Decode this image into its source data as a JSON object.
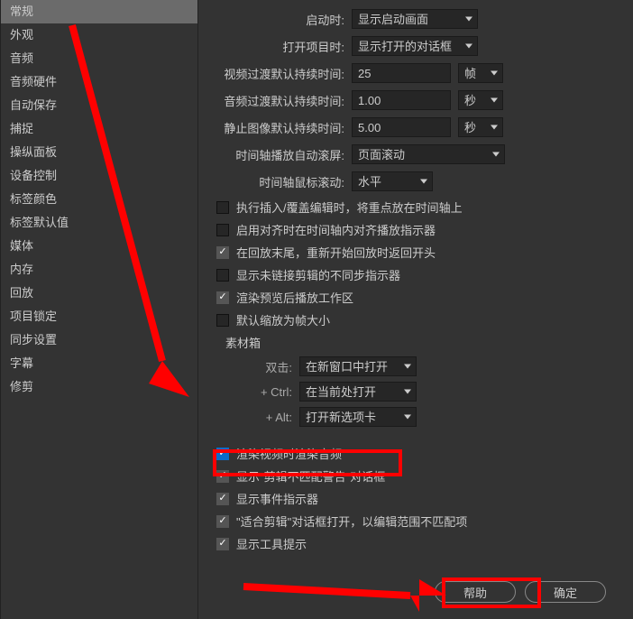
{
  "sidebar": {
    "items": [
      {
        "label": "常规",
        "name": "sidebar-item-general",
        "active": true
      },
      {
        "label": "外观",
        "name": "sidebar-item-appearance"
      },
      {
        "label": "音频",
        "name": "sidebar-item-audio"
      },
      {
        "label": "音频硬件",
        "name": "sidebar-item-audio-hardware"
      },
      {
        "label": "自动保存",
        "name": "sidebar-item-autosave"
      },
      {
        "label": "捕捉",
        "name": "sidebar-item-capture"
      },
      {
        "label": "操纵面板",
        "name": "sidebar-item-control-surface"
      },
      {
        "label": "设备控制",
        "name": "sidebar-item-device-control"
      },
      {
        "label": "标签颜色",
        "name": "sidebar-item-label-colors"
      },
      {
        "label": "标签默认值",
        "name": "sidebar-item-label-defaults"
      },
      {
        "label": "媒体",
        "name": "sidebar-item-media"
      },
      {
        "label": "内存",
        "name": "sidebar-item-memory"
      },
      {
        "label": "回放",
        "name": "sidebar-item-playback"
      },
      {
        "label": "项目锁定",
        "name": "sidebar-item-project-lock"
      },
      {
        "label": "同步设置",
        "name": "sidebar-item-sync-settings"
      },
      {
        "label": "字幕",
        "name": "sidebar-item-captions"
      },
      {
        "label": "修剪",
        "name": "sidebar-item-trim"
      }
    ]
  },
  "main": {
    "startup_label": "启动时:",
    "startup_value": "显示启动画面",
    "open_project_label": "打开项目时:",
    "open_project_value": "显示打开的对话框",
    "video_transition_label": "视频过渡默认持续时间:",
    "video_transition_value": "25",
    "video_transition_unit": "帧",
    "audio_transition_label": "音频过渡默认持续时间:",
    "audio_transition_value": "1.00",
    "audio_transition_unit": "秒",
    "still_image_label": "静止图像默认持续时间:",
    "still_image_value": "5.00",
    "still_image_unit": "秒",
    "timeline_autoscroll_label": "时间轴播放自动滚屏:",
    "timeline_autoscroll_value": "页面滚动",
    "timeline_mousewheel_label": "时间轴鼠标滚动:",
    "timeline_mousewheel_value": "水平",
    "checkboxes": [
      {
        "label": "执行插入/覆盖编辑时，将重点放在时间轴上",
        "checked": false,
        "name": "cb-focus-timeline"
      },
      {
        "label": "启用对齐时在时间轴内对齐播放指示器",
        "checked": false,
        "name": "cb-snap-playhead"
      },
      {
        "label": "在回放末尾，重新开始回放时返回开头",
        "checked": true,
        "name": "cb-return-start"
      },
      {
        "label": "显示未链接剪辑的不同步指示器",
        "checked": false,
        "name": "cb-unsync-indicator"
      },
      {
        "label": "渲染预览后播放工作区",
        "checked": true,
        "name": "cb-play-after-render"
      },
      {
        "label": "默认缩放为帧大小",
        "checked": false,
        "name": "cb-default-scale"
      }
    ],
    "bin_section_label": "素材箱",
    "bin": {
      "doubleclick_label": "双击:",
      "doubleclick_value": "在新窗口中打开",
      "ctrl_label": "+ Ctrl:",
      "ctrl_value": "在当前处打开",
      "alt_label": "+ Alt:",
      "alt_value": "打开新选项卡"
    },
    "checkboxes2": [
      {
        "label": "渲染视频时渲染音频",
        "checked": true,
        "checkedBlue": true,
        "name": "cb-render-audio"
      },
      {
        "label": "显示\"剪辑不匹配警告\"对话框",
        "checked": true,
        "name": "cb-clip-mismatch"
      },
      {
        "label": "显示事件指示器",
        "checked": true,
        "name": "cb-event-indicator"
      },
      {
        "label": "\"适合剪辑\"对话框打开，以编辑范围不匹配项",
        "checked": true,
        "name": "cb-fit-clip"
      },
      {
        "label": "显示工具提示",
        "checked": true,
        "name": "cb-tooltips"
      }
    ]
  },
  "buttons": {
    "help": "帮助",
    "ok": "确定"
  }
}
